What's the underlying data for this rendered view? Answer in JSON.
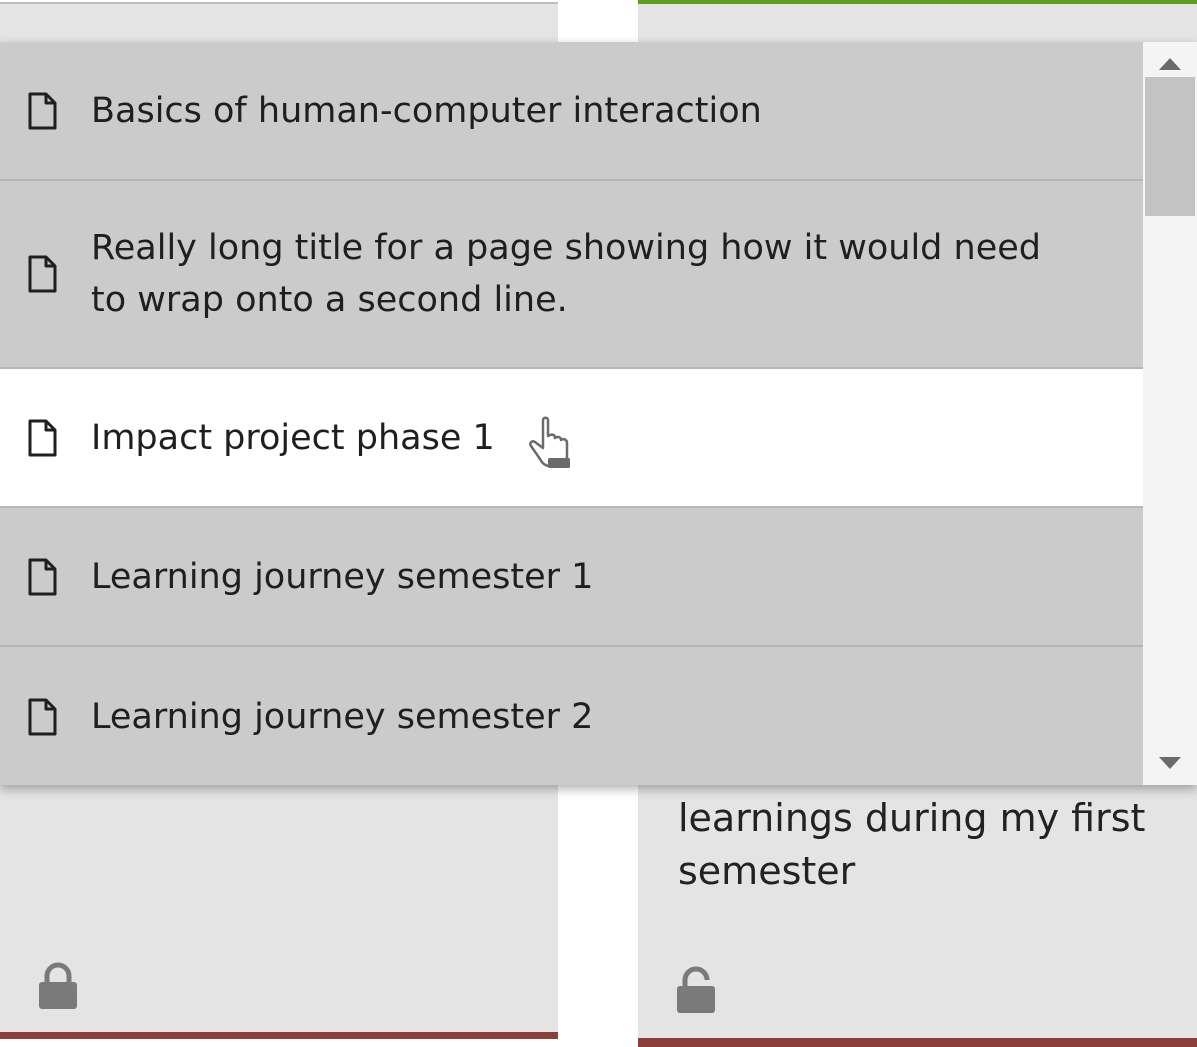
{
  "background_cards": {
    "left": {
      "lock_icon": "lock-closed-icon"
    },
    "right": {
      "description": "learnings during my first semester",
      "lock_icon": "lock-open-icon"
    }
  },
  "dropdown": {
    "items": [
      {
        "label": "Basics of human-computer interaction",
        "icon": "file-icon",
        "state": "default"
      },
      {
        "label": "Really long title for a page showing how it would need to wrap onto a second line.",
        "icon": "file-icon",
        "state": "default"
      },
      {
        "label": "Impact project phase 1",
        "icon": "file-icon",
        "state": "hovered"
      },
      {
        "label": "Learning journey semester 1",
        "icon": "file-icon",
        "state": "default"
      },
      {
        "label": "Learning journey semester 2",
        "icon": "file-icon",
        "state": "default"
      }
    ],
    "cursor_icon": "pointer-hand-icon",
    "scrollbar": {
      "up_icon": "triangle-up-icon",
      "down_icon": "triangle-down-icon"
    }
  },
  "colors": {
    "dropdown_bg": "#cbcbcb",
    "hover_bg": "#ffffff",
    "card_bg": "#e4e4e4",
    "card_bottom_border": "#8c3f3a",
    "card_top_accent": "#5f9e1a",
    "icon_color": "#7a7a7a"
  }
}
